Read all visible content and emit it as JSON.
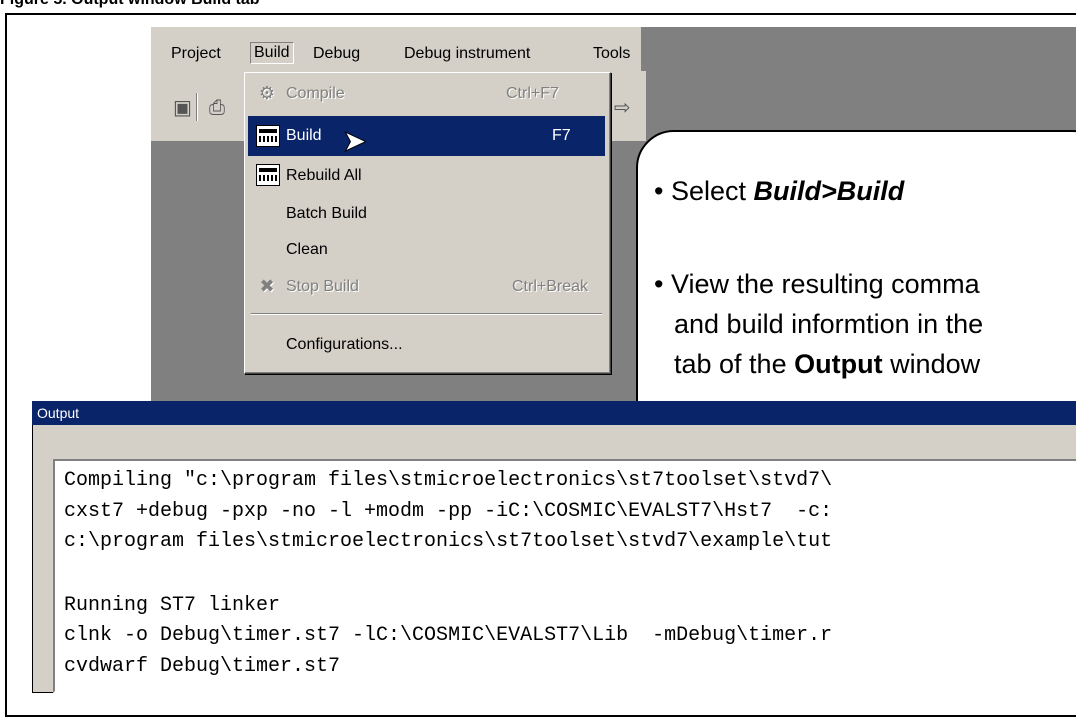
{
  "caption": "Figure 5.     Output window Build tab",
  "menubar": {
    "items": [
      {
        "label": "Project"
      },
      {
        "label": "Build"
      },
      {
        "label": "Debug"
      },
      {
        "label": "Debug instrument"
      },
      {
        "label": "Tools"
      }
    ]
  },
  "dropdown": {
    "items": [
      {
        "label": "Compile",
        "shortcut": "Ctrl+F7",
        "icon": "compile-icon",
        "disabled": true
      },
      {
        "label": "Build",
        "shortcut": "F7",
        "icon": "build-icon",
        "highlighted": true
      },
      {
        "label": "Rebuild All",
        "icon": "rebuild-all-icon"
      },
      {
        "label": "Batch Build"
      },
      {
        "label": "Clean"
      },
      {
        "label": "Stop Build",
        "shortcut": "Ctrl+Break",
        "icon": "stop-build-icon",
        "disabled": true
      },
      {
        "label": "Configurations..."
      }
    ]
  },
  "callout": {
    "bullet1_prefix": "• Select ",
    "bullet1_bold": "Build>Build",
    "bullet2_line1": "• View the resulting comma",
    "bullet2_line2": "and build informtion in the",
    "bullet2_line3_prefix": "tab of the ",
    "bullet2_line3_bold": "Output",
    "bullet2_line3_suffix": " window"
  },
  "output": {
    "title": "Output",
    "lines": [
      "Compiling \"c:\\program files\\stmicroelectronics\\st7toolset\\stvd7\\",
      "cxst7 +debug -pxp -no -l +modm -pp -iC:\\COSMIC\\EVALST7\\Hst7  -c:",
      "c:\\program files\\stmicroelectronics\\st7toolset\\stvd7\\example\\tut",
      "",
      "Running ST7 linker",
      "clnk -o Debug\\timer.st7 -lC:\\COSMIC\\EVALST7\\Lib  -mDebug\\timer.r",
      "cvdwarf Debug\\timer.st7"
    ]
  }
}
